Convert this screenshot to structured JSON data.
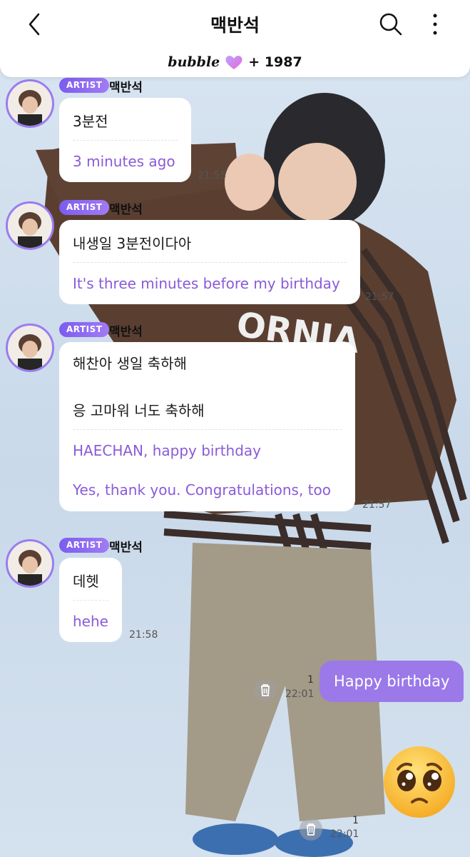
{
  "header": {
    "back_label": "back",
    "title": "맥반석",
    "brand": "bubble",
    "count": "+ 1987"
  },
  "messages": [
    {
      "badge": "ARTIST",
      "sender": "맥반석",
      "ko": [
        "3분전"
      ],
      "en": [
        "3 minutes ago"
      ],
      "time": "21:55"
    },
    {
      "badge": "ARTIST",
      "sender": "맥반석",
      "ko": [
        "내생일 3분전이다아"
      ],
      "en": [
        "It's three minutes before my birthday"
      ],
      "time": "21:57"
    },
    {
      "badge": "ARTIST",
      "sender": "맥반석",
      "ko": [
        "해찬아 생일 축하해",
        "응 고마워 너도 축하해"
      ],
      "en": [
        "HAECHAN, happy birthday",
        "Yes, thank you. Congratulations, too"
      ],
      "time": "21:57"
    },
    {
      "badge": "ARTIST",
      "sender": "맥반석",
      "ko": [
        "데헷"
      ],
      "en": [
        "hehe"
      ],
      "time": "21:58"
    }
  ],
  "my_messages": [
    {
      "text": "Happy birthday",
      "read": "1",
      "time": "22:01"
    },
    {
      "emoji": "pleading-face",
      "read": "1",
      "time": "22:01"
    }
  ],
  "colors": {
    "accent": "#9b79e8",
    "translation": "#8a5ad8",
    "badge": "#7b5cf0"
  }
}
